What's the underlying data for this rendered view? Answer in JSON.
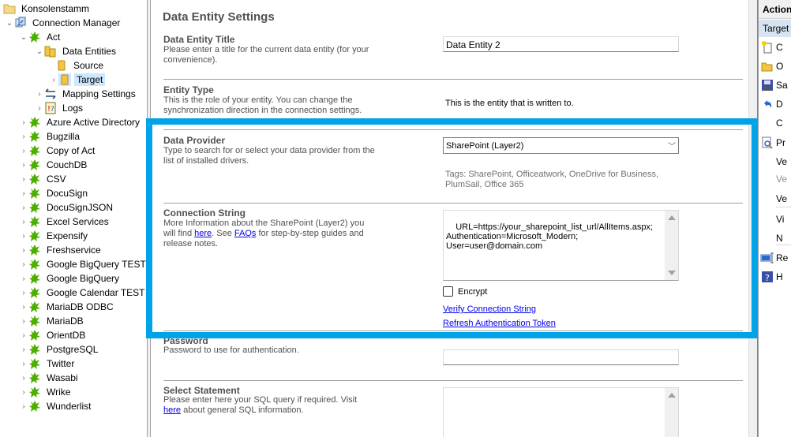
{
  "tree": {
    "root": "Konsolenstamm",
    "connection_manager": "Connection Manager",
    "act": "Act",
    "data_entities": "Data Entities",
    "source": "Source",
    "target": "Target",
    "mapping_settings": "Mapping Settings",
    "logs": "Logs",
    "connections": [
      "Azure Active Directory",
      "Bugzilla",
      "Copy of Act",
      "CouchDB",
      "CSV",
      "DocuSign",
      "DocuSignJSON",
      "Excel Services",
      "Expensify",
      "Freshservice",
      "Google BigQuery TEST",
      "Google BigQuery",
      "Google Calendar TEST",
      "MariaDB ODBC",
      "MariaDB",
      "OrientDB",
      "PostgreSQL",
      "Twitter",
      "Wasabi",
      "Wrike",
      "Wunderlist"
    ]
  },
  "main": {
    "page_title": "Data Entity Settings",
    "title_section": {
      "label": "Data Entity Title",
      "description": "Please enter a title for the current data entity (for your convenience).",
      "value": "Data Entity 2"
    },
    "entity_type": {
      "label": "Entity Type",
      "description": "This is the role of your entity. You can change the synchronization direction in the connection settings.",
      "value": "This is the entity that is written to."
    },
    "data_provider": {
      "label": "Data Provider",
      "description": "Type to search for or select your data provider from the list of installed drivers.",
      "selected": "SharePoint (Layer2)",
      "tags": "Tags: SharePoint, Officeatwork, OneDrive for Business, PlumSail, Office 365"
    },
    "connection_string": {
      "label": "Connection String",
      "desc_part1": "More Information about the SharePoint (Layer2) you will find ",
      "desc_link1": "here",
      "desc_part2": ". See ",
      "desc_link2": "FAQs",
      "desc_part3": " for step-by-step guides and release notes.",
      "value": "URL=https://your_sharepoint_list_url/AllItems.aspx;\nAuthentication=Microsoft_Modern;\nUser=user@domain.com",
      "encrypt_label": "Encrypt",
      "encrypt_checked": false,
      "verify_link": "Verify Connection String",
      "refresh_link": "Refresh Authentication Token"
    },
    "password": {
      "label": "Password",
      "description": "Password to use for authentication.",
      "value": ""
    },
    "select_statement": {
      "label": "Select Statement",
      "desc_part1": "Please enter here your SQL query if required. Visit ",
      "desc_link": "here",
      "desc_part2": " about general SQL information.",
      "value": ""
    }
  },
  "actions": {
    "header": "Actions",
    "subheader": "Target",
    "items": [
      {
        "label": "C",
        "icon": "new-document-icon"
      },
      {
        "label": "O",
        "icon": "open-folder-icon"
      },
      {
        "label": "Sa",
        "icon": "save-icon"
      },
      {
        "label": "D",
        "icon": "undo-icon"
      },
      {
        "label": "C",
        "icon": ""
      },
      {
        "label": "Pr",
        "icon": "preview-icon"
      },
      {
        "label": "Ve",
        "icon": ""
      },
      {
        "label": "Ve",
        "icon": "",
        "disabled": true
      },
      {
        "label": "Ve",
        "icon": ""
      },
      {
        "label": "Vi",
        "icon": ""
      },
      {
        "label": "N",
        "icon": ""
      },
      {
        "label": "Re",
        "icon": "rename-icon"
      },
      {
        "label": "H",
        "icon": "help-icon"
      }
    ]
  },
  "colors": {
    "highlight": "#00a2e8",
    "selection": "#cce8ff",
    "connection_icon": "#4caf00",
    "link": "#0000ee"
  }
}
